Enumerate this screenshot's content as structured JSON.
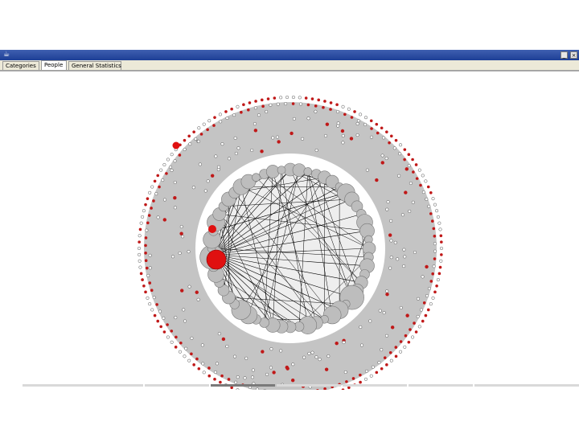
{
  "window": {
    "app_icon": "java-cup-icon",
    "controls": {
      "minimize": "_",
      "close": "×"
    }
  },
  "tabs": [
    {
      "label": "Categories",
      "active": false
    },
    {
      "label": "People",
      "active": true
    },
    {
      "label": "General Statistics",
      "active": false
    }
  ],
  "graph": {
    "colors": {
      "ring_fill": "#c4c4c4",
      "node_gray": "#bdbdbd",
      "node_red": "#e01010",
      "edge": "#000000",
      "dot_red": "#c01818",
      "dot_white": "#ffffff"
    }
  }
}
